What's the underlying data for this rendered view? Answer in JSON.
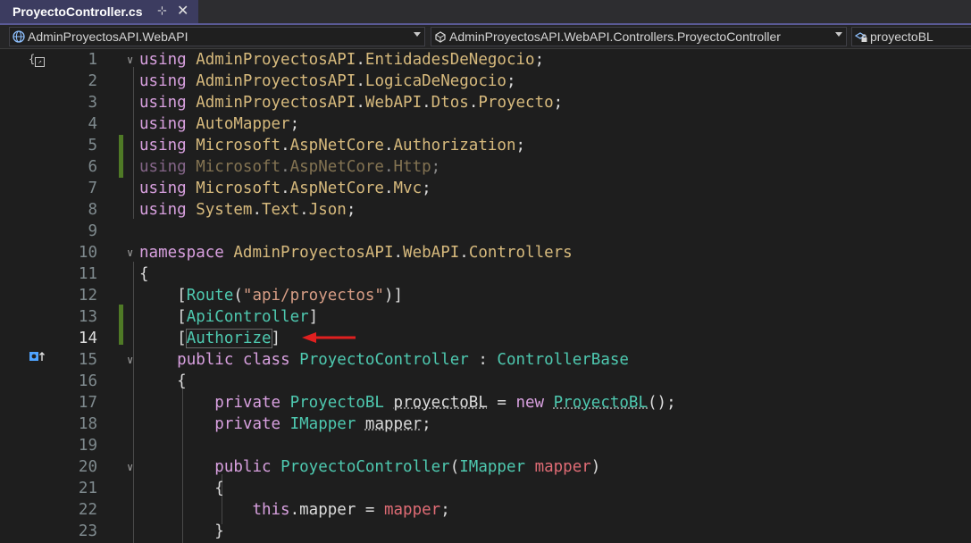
{
  "tab": {
    "title": "ProyectoController.cs",
    "pin": "⊹",
    "close": "✕"
  },
  "nav": {
    "project": "AdminProyectosAPI.WebAPI",
    "type": "AdminProyectosAPI.WebAPI.Controllers.ProyectoController",
    "member": "proyectoBL"
  },
  "lines": [
    {
      "n": "1",
      "code": "using AdminProyectosAPI.EntidadesDeNegocio;"
    },
    {
      "n": "2",
      "code": "using AdminProyectosAPI.LogicaDeNegocio;"
    },
    {
      "n": "3",
      "code": "using AdminProyectosAPI.WebAPI.Dtos.Proyecto;"
    },
    {
      "n": "4",
      "code": "using AutoMapper;"
    },
    {
      "n": "5",
      "code": "using Microsoft.AspNetCore.Authorization;"
    },
    {
      "n": "6",
      "code": "using Microsoft.AspNetCore.Http;"
    },
    {
      "n": "7",
      "code": "using Microsoft.AspNetCore.Mvc;"
    },
    {
      "n": "8",
      "code": "using System.Text.Json;"
    },
    {
      "n": "9",
      "code": ""
    },
    {
      "n": "10",
      "code": "namespace AdminProyectosAPI.WebAPI.Controllers"
    },
    {
      "n": "11",
      "code": "{"
    },
    {
      "n": "12",
      "code": "    [Route(\"api/proyectos\")]"
    },
    {
      "n": "13",
      "code": "    [ApiController]"
    },
    {
      "n": "14",
      "code": "    [Authorize]"
    },
    {
      "n": "15",
      "code": "    public class ProyectoController : ControllerBase"
    },
    {
      "n": "16",
      "code": "    {"
    },
    {
      "n": "17",
      "code": "        private ProyectoBL proyectoBL = new ProyectoBL();"
    },
    {
      "n": "18",
      "code": "        private IMapper mapper;"
    },
    {
      "n": "19",
      "code": ""
    },
    {
      "n": "20",
      "code": "        public ProyectoController(IMapper mapper)"
    },
    {
      "n": "21",
      "code": "        {"
    },
    {
      "n": "22",
      "code": "            this.mapper = mapper;"
    },
    {
      "n": "23",
      "code": "        }"
    }
  ]
}
